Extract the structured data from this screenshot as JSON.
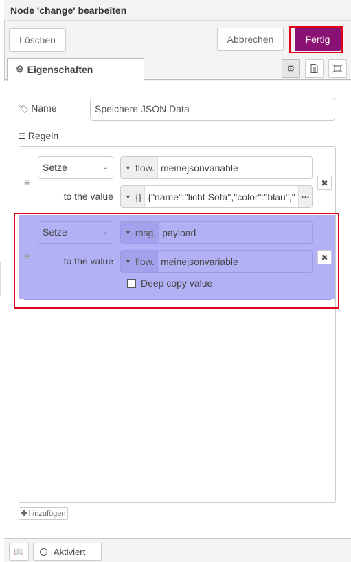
{
  "header": {
    "title": "Node 'change' bearbeiten"
  },
  "toolbar": {
    "delete_label": "Löschen",
    "cancel_label": "Abbrechen",
    "done_label": "Fertig"
  },
  "tabs": {
    "properties_label": "Eigenschaften",
    "icons": [
      "gear-icon",
      "description-icon",
      "appearance-icon"
    ]
  },
  "form": {
    "name_label": "Name",
    "name_value": "Speichere JSON Data",
    "rules_label": "Regeln",
    "rules": [
      {
        "action": "Setze",
        "target_type": "flow.",
        "target_value": "meinejsonvariable",
        "to_label": "to the value",
        "value_type": "{}",
        "value": "{\"name\":\"licht Sofa\",\"color\":\"blau\",\"",
        "value_more": "⋯"
      },
      {
        "action": "Setze",
        "target_type": "msg.",
        "target_value": "payload",
        "to_label": "to the value",
        "value_type": "flow.",
        "value": "meinejsonvariable",
        "deep_copy_label": "Deep copy value",
        "deep_copy_checked": false
      }
    ],
    "add_label": "hinzufügen"
  },
  "footer": {
    "status_label": "Aktiviert"
  },
  "colors": {
    "done_button": "#8a1275",
    "highlight": "#e0001a",
    "selected_rule": "#b3b1f5"
  }
}
